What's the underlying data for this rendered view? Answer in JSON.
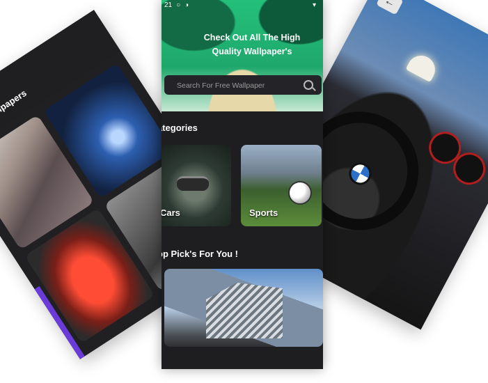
{
  "left_phone": {
    "back_icon": "arrow-left-icon",
    "title": "Cars Wallpapers"
  },
  "right_phone": {
    "back_icon": "arrow-left-icon"
  },
  "center_phone": {
    "status": {
      "time": "21",
      "wifi_icon": "wifi-icon"
    },
    "hero_title": "Check Out All The High Quality Wallpaper's",
    "search": {
      "placeholder": "Search For Free Wallpaper",
      "icon": "search-icon"
    },
    "sections": {
      "categories_title": "ategories",
      "top_picks_title": "op Pick's For You !"
    },
    "categories": [
      {
        "label": "Cars"
      },
      {
        "label": "Sports"
      }
    ]
  },
  "colors": {
    "background": "#ffffff",
    "phone_bg": "#1e1e20",
    "hero_green": "#23c07a",
    "left_accent": "#6b3bd9"
  }
}
